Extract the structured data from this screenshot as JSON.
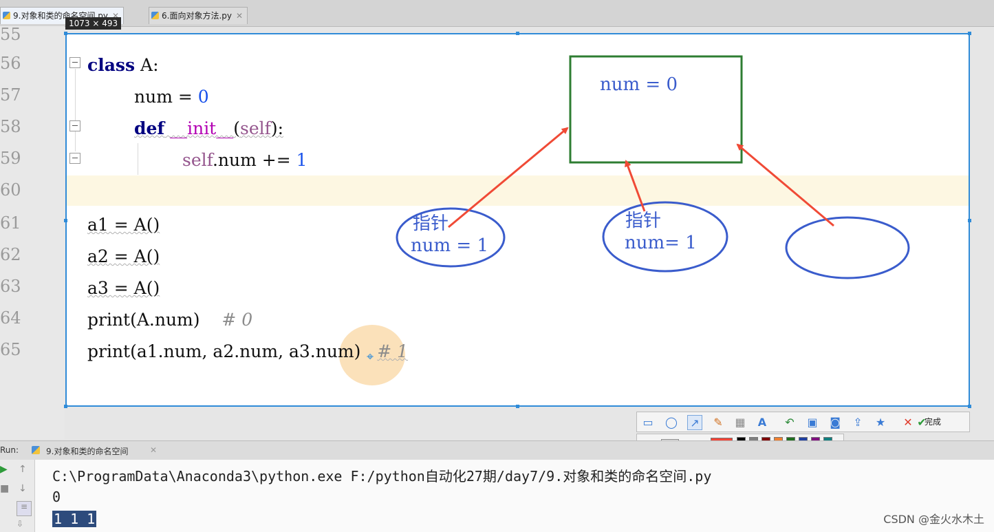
{
  "tabs": [
    {
      "label": "9.对象和类的命名空间.py",
      "active": true
    },
    {
      "label": "6.面向对象方法.py",
      "active": false
    }
  ],
  "gutter_lines": [
    "55",
    "56",
    "57",
    "58",
    "59",
    "60",
    "61",
    "62",
    "63",
    "64",
    "65"
  ],
  "capture_size": "1073 × 493",
  "code": {
    "l1_kw": "class",
    "l1_rest": " A:",
    "l2_name": "num",
    "l2_eq": " = ",
    "l2_val": "0",
    "l3_kw": "def",
    "l3_fn": "__init__",
    "l3_open": "(",
    "l3_self": "self",
    "l3_close": "):",
    "l4_self": "self",
    "l4_rest": ".num += ",
    "l4_val": "1",
    "l5": "a1 = A()",
    "l6": "a2 = A()",
    "l7": "a3 = A()",
    "l8_code": "print(A.num)",
    "l8_comment": "# 0",
    "l9_code": "print(a1.num, a2.num, a3.num)",
    "l9_comment": "# 1"
  },
  "annotations": {
    "box_text": "num = 0",
    "ellipse1_line1": "指针",
    "ellipse1_line2": "num = 1",
    "ellipse2_line1": "指针",
    "ellipse2_line2": "num= 1",
    "ink_color": "#3a5ccc",
    "arrow_color": "#f04a36",
    "box_color": "#2e7d32"
  },
  "toolbar": {
    "tools": [
      "rectangle-icon",
      "ellipse-icon",
      "arrow-icon",
      "pen-icon",
      "mosaic-icon",
      "text-icon",
      "undo-icon",
      "save-icon",
      "pin-icon",
      "share-icon",
      "favorite-icon",
      "cancel-icon",
      "confirm-icon"
    ],
    "done_label": "完成",
    "selected_color": "#f44336",
    "palette": [
      "#000000",
      "#808080",
      "#800000",
      "#f08030",
      "#207020",
      "#2040a0",
      "#801080",
      "#108080",
      "#ffffff",
      "#c0c0c0",
      "#f44336",
      "#ffe000",
      "#80c020",
      "#3090f0",
      "#f040f0",
      "#20c0e0"
    ]
  },
  "run": {
    "label": "Run:",
    "tab_label": "9.对象和类的命名空间",
    "command": "C:\\ProgramData\\Anaconda3\\python.exe F:/python自动化27期/day7/9.对象和类的命名空间.py",
    "out1": "0",
    "out2": "1 1 1"
  },
  "watermark": "CSDN @金火水木土"
}
